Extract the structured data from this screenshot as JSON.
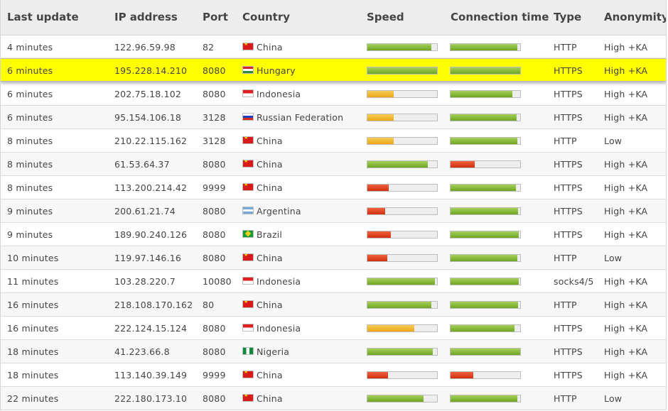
{
  "columns": {
    "last_update": "Last update",
    "ip": "IP address",
    "port": "Port",
    "country": "Country",
    "speed": "Speed",
    "connection_time": "Connection time",
    "type": "Type",
    "anonymity": "Anonymity"
  },
  "colors": {
    "header_bg": "#ededed",
    "row_alt_bg": "#f7f7f7",
    "highlight": "#ffff00",
    "bar_green": "#7ab332",
    "bar_orange": "#f0b63a",
    "bar_red": "#e04020"
  },
  "rows": [
    {
      "last_update": "4 minutes",
      "ip": "122.96.59.98",
      "port": "82",
      "country": "China",
      "flag": "china-flag-icon",
      "speed": 0.92,
      "speed_level": "green",
      "conn": 0.96,
      "conn_level": "green",
      "type": "HTTP",
      "anonymity": "High +KA"
    },
    {
      "last_update": "6 minutes",
      "ip": "195.228.14.210",
      "port": "8080",
      "country": "Hungary",
      "flag": "hungary-flag-icon",
      "speed": 1.0,
      "speed_level": "green",
      "conn": 1.0,
      "conn_level": "green",
      "type": "HTTPS",
      "anonymity": "High +KA",
      "highlighted": true
    },
    {
      "last_update": "6 minutes",
      "ip": "202.75.18.102",
      "port": "8080",
      "country": "Indonesia",
      "flag": "indonesia-flag-icon",
      "speed": 0.38,
      "speed_level": "orange",
      "conn": 0.89,
      "conn_level": "green",
      "type": "HTTPS",
      "anonymity": "High +KA"
    },
    {
      "last_update": "6 minutes",
      "ip": "95.154.106.18",
      "port": "3128",
      "country": "Russian Federation",
      "flag": "russia-flag-icon",
      "speed": 0.38,
      "speed_level": "orange",
      "conn": 0.95,
      "conn_level": "green",
      "type": "HTTPS",
      "anonymity": "High +KA"
    },
    {
      "last_update": "8 minutes",
      "ip": "210.22.115.162",
      "port": "3128",
      "country": "China",
      "flag": "china-flag-icon",
      "speed": 0.38,
      "speed_level": "orange",
      "conn": 0.96,
      "conn_level": "green",
      "type": "HTTP",
      "anonymity": "Low"
    },
    {
      "last_update": "8 minutes",
      "ip": "61.53.64.37",
      "port": "8080",
      "country": "China",
      "flag": "china-flag-icon",
      "speed": 0.87,
      "speed_level": "green",
      "conn": 0.35,
      "conn_level": "red",
      "type": "HTTPS",
      "anonymity": "High +KA"
    },
    {
      "last_update": "8 minutes",
      "ip": "113.200.214.42",
      "port": "9999",
      "country": "China",
      "flag": "china-flag-icon",
      "speed": 0.31,
      "speed_level": "red",
      "conn": 0.94,
      "conn_level": "green",
      "type": "HTTPS",
      "anonymity": "High +KA"
    },
    {
      "last_update": "9 minutes",
      "ip": "200.61.21.74",
      "port": "8080",
      "country": "Argentina",
      "flag": "argentina-flag-icon",
      "speed": 0.26,
      "speed_level": "red",
      "conn": 0.97,
      "conn_level": "green",
      "type": "HTTPS",
      "anonymity": "High +KA"
    },
    {
      "last_update": "9 minutes",
      "ip": "189.90.240.126",
      "port": "8080",
      "country": "Brazil",
      "flag": "brazil-flag-icon",
      "speed": 0.34,
      "speed_level": "red",
      "conn": 0.98,
      "conn_level": "green",
      "type": "HTTPS",
      "anonymity": "High +KA"
    },
    {
      "last_update": "10 minutes",
      "ip": "119.97.146.16",
      "port": "8080",
      "country": "China",
      "flag": "china-flag-icon",
      "speed": 0.29,
      "speed_level": "red",
      "conn": 0.96,
      "conn_level": "green",
      "type": "HTTP",
      "anonymity": "Low"
    },
    {
      "last_update": "11 minutes",
      "ip": "103.28.220.7",
      "port": "10080",
      "country": "Indonesia",
      "flag": "indonesia-flag-icon",
      "speed": 0.97,
      "speed_level": "green",
      "conn": 0.98,
      "conn_level": "green",
      "type": "socks4/5",
      "anonymity": "High +KA"
    },
    {
      "last_update": "16 minutes",
      "ip": "218.108.170.162",
      "port": "80",
      "country": "China",
      "flag": "china-flag-icon",
      "speed": 0.92,
      "speed_level": "green",
      "conn": 0.97,
      "conn_level": "green",
      "type": "HTTP",
      "anonymity": "High +KA"
    },
    {
      "last_update": "16 minutes",
      "ip": "222.124.15.124",
      "port": "8080",
      "country": "Indonesia",
      "flag": "indonesia-flag-icon",
      "speed": 0.67,
      "speed_level": "orange",
      "conn": 0.92,
      "conn_level": "green",
      "type": "HTTPS",
      "anonymity": "High +KA"
    },
    {
      "last_update": "18 minutes",
      "ip": "41.223.66.8",
      "port": "8080",
      "country": "Nigeria",
      "flag": "nigeria-flag-icon",
      "speed": 0.94,
      "speed_level": "green",
      "conn": 1.0,
      "conn_level": "green",
      "type": "HTTPS",
      "anonymity": "High +KA"
    },
    {
      "last_update": "18 minutes",
      "ip": "113.140.39.149",
      "port": "9999",
      "country": "China",
      "flag": "china-flag-icon",
      "speed": 0.3,
      "speed_level": "red",
      "conn": 0.33,
      "conn_level": "red",
      "type": "HTTPS",
      "anonymity": "High +KA"
    },
    {
      "last_update": "22 minutes",
      "ip": "222.180.173.10",
      "port": "8080",
      "country": "China",
      "flag": "china-flag-icon",
      "speed": 0.81,
      "speed_level": "green",
      "conn": 0.96,
      "conn_level": "green",
      "type": "HTTP",
      "anonymity": "Low"
    }
  ]
}
